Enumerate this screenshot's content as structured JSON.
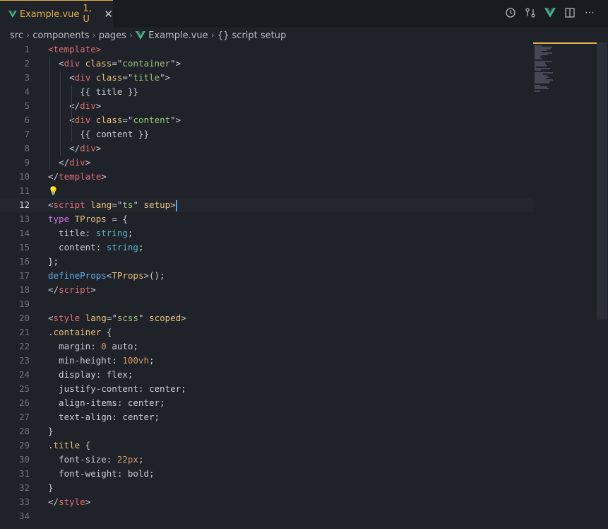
{
  "tab": {
    "filename": "Example.vue",
    "status": "1, U",
    "close": "✕"
  },
  "actions": [
    "history-icon",
    "compare-icon",
    "vue-icon",
    "split-icon",
    "more-icon"
  ],
  "breadcrumb": {
    "items": [
      "src",
      "components",
      "pages",
      "Example.vue",
      "{} script setup"
    ],
    "sep": "›"
  },
  "active_line": 12,
  "lines": [
    {
      "n": "1"
    },
    {
      "n": "2"
    },
    {
      "n": "3"
    },
    {
      "n": "4"
    },
    {
      "n": "5"
    },
    {
      "n": "6"
    },
    {
      "n": "7"
    },
    {
      "n": "8"
    },
    {
      "n": "9"
    },
    {
      "n": "10"
    },
    {
      "n": "11"
    },
    {
      "n": "12"
    },
    {
      "n": "13"
    },
    {
      "n": "14"
    },
    {
      "n": "15"
    },
    {
      "n": "16"
    },
    {
      "n": "17"
    },
    {
      "n": "18"
    },
    {
      "n": "19"
    },
    {
      "n": "20"
    },
    {
      "n": "21"
    },
    {
      "n": "22"
    },
    {
      "n": "23"
    },
    {
      "n": "24"
    },
    {
      "n": "25"
    },
    {
      "n": "26"
    },
    {
      "n": "27"
    },
    {
      "n": "28"
    },
    {
      "n": "29"
    },
    {
      "n": "30"
    },
    {
      "n": "31"
    },
    {
      "n": "32"
    },
    {
      "n": "33"
    },
    {
      "n": "34"
    }
  ],
  "code": [
    [
      [
        "tg",
        "<template>"
      ]
    ],
    [
      [
        "br",
        "  <"
      ],
      [
        "tg",
        "div"
      ],
      [
        "br",
        " "
      ],
      [
        "at",
        "class"
      ],
      [
        "br",
        "=\""
      ],
      [
        "st",
        "container"
      ],
      [
        "br",
        "\">"
      ]
    ],
    [
      [
        "br",
        "    <"
      ],
      [
        "tg",
        "div"
      ],
      [
        "br",
        " "
      ],
      [
        "at",
        "class"
      ],
      [
        "br",
        "=\""
      ],
      [
        "st",
        "title"
      ],
      [
        "br",
        "\">"
      ]
    ],
    [
      [
        "br",
        "      {{ title }}"
      ]
    ],
    [
      [
        "br",
        "    </"
      ],
      [
        "tg",
        "div"
      ],
      [
        "br",
        ">"
      ]
    ],
    [
      [
        "br",
        "    <"
      ],
      [
        "tg",
        "div"
      ],
      [
        "br",
        " "
      ],
      [
        "at",
        "class"
      ],
      [
        "br",
        "=\""
      ],
      [
        "st",
        "content"
      ],
      [
        "br",
        "\">"
      ]
    ],
    [
      [
        "br",
        "      {{ content }}"
      ]
    ],
    [
      [
        "br",
        "    </"
      ],
      [
        "tg",
        "div"
      ],
      [
        "br",
        ">"
      ]
    ],
    [
      [
        "br",
        "  </"
      ],
      [
        "tg",
        "div"
      ],
      [
        "br",
        ">"
      ]
    ],
    [
      [
        "br",
        "</"
      ],
      [
        "tg",
        "template"
      ],
      [
        "br",
        ">"
      ]
    ],
    [],
    [
      [
        "br",
        "<"
      ],
      [
        "tg",
        "script"
      ],
      [
        "br",
        " "
      ],
      [
        "at",
        "lang"
      ],
      [
        "br",
        "=\""
      ],
      [
        "st",
        "ts"
      ],
      [
        "br",
        "\" "
      ],
      [
        "at",
        "setup"
      ],
      [
        "br",
        ">"
      ]
    ],
    [
      [
        "kw",
        "type"
      ],
      [
        "br",
        " "
      ],
      [
        "ty",
        "TProps"
      ],
      [
        "br",
        " = {"
      ]
    ],
    [
      [
        "br",
        "  title: "
      ],
      [
        "tt",
        "string"
      ],
      [
        "br",
        ";"
      ]
    ],
    [
      [
        "br",
        "  content: "
      ],
      [
        "tt",
        "string"
      ],
      [
        "br",
        ";"
      ]
    ],
    [
      [
        "br",
        "};"
      ]
    ],
    [
      [
        "fn",
        "defineProps"
      ],
      [
        "br",
        "<"
      ],
      [
        "ty",
        "TProps"
      ],
      [
        "br",
        ">();"
      ]
    ],
    [
      [
        "br",
        "</"
      ],
      [
        "tg",
        "script"
      ],
      [
        "br",
        ">"
      ]
    ],
    [],
    [
      [
        "br",
        "<"
      ],
      [
        "tg",
        "style"
      ],
      [
        "br",
        " "
      ],
      [
        "at",
        "lang"
      ],
      [
        "br",
        "=\""
      ],
      [
        "st",
        "scss"
      ],
      [
        "br",
        "\" "
      ],
      [
        "at",
        "scoped"
      ],
      [
        "br",
        ">"
      ]
    ],
    [
      [
        "se",
        ".container"
      ],
      [
        "br",
        " {"
      ]
    ],
    [
      [
        "br",
        "  margin: "
      ],
      [
        "nu",
        "0"
      ],
      [
        "br",
        " auto;"
      ]
    ],
    [
      [
        "br",
        "  min-height: "
      ],
      [
        "nu",
        "100vh"
      ],
      [
        "br",
        ";"
      ]
    ],
    [
      [
        "br",
        "  display: flex;"
      ]
    ],
    [
      [
        "br",
        "  justify-content: center;"
      ]
    ],
    [
      [
        "br",
        "  align-items: center;"
      ]
    ],
    [
      [
        "br",
        "  text-align: center;"
      ]
    ],
    [
      [
        "br",
        "}"
      ]
    ],
    [
      [
        "se",
        ".title"
      ],
      [
        "br",
        " {"
      ]
    ],
    [
      [
        "br",
        "  font-size: "
      ],
      [
        "nu",
        "22px"
      ],
      [
        "br",
        ";"
      ]
    ],
    [
      [
        "br",
        "  font-weight: bold;"
      ]
    ],
    [
      [
        "br",
        "}"
      ]
    ],
    [
      [
        "br",
        "</"
      ],
      [
        "tg",
        "style"
      ],
      [
        "br",
        ">"
      ]
    ],
    []
  ],
  "bulb_line": 11,
  "bulb_icon": "💡"
}
